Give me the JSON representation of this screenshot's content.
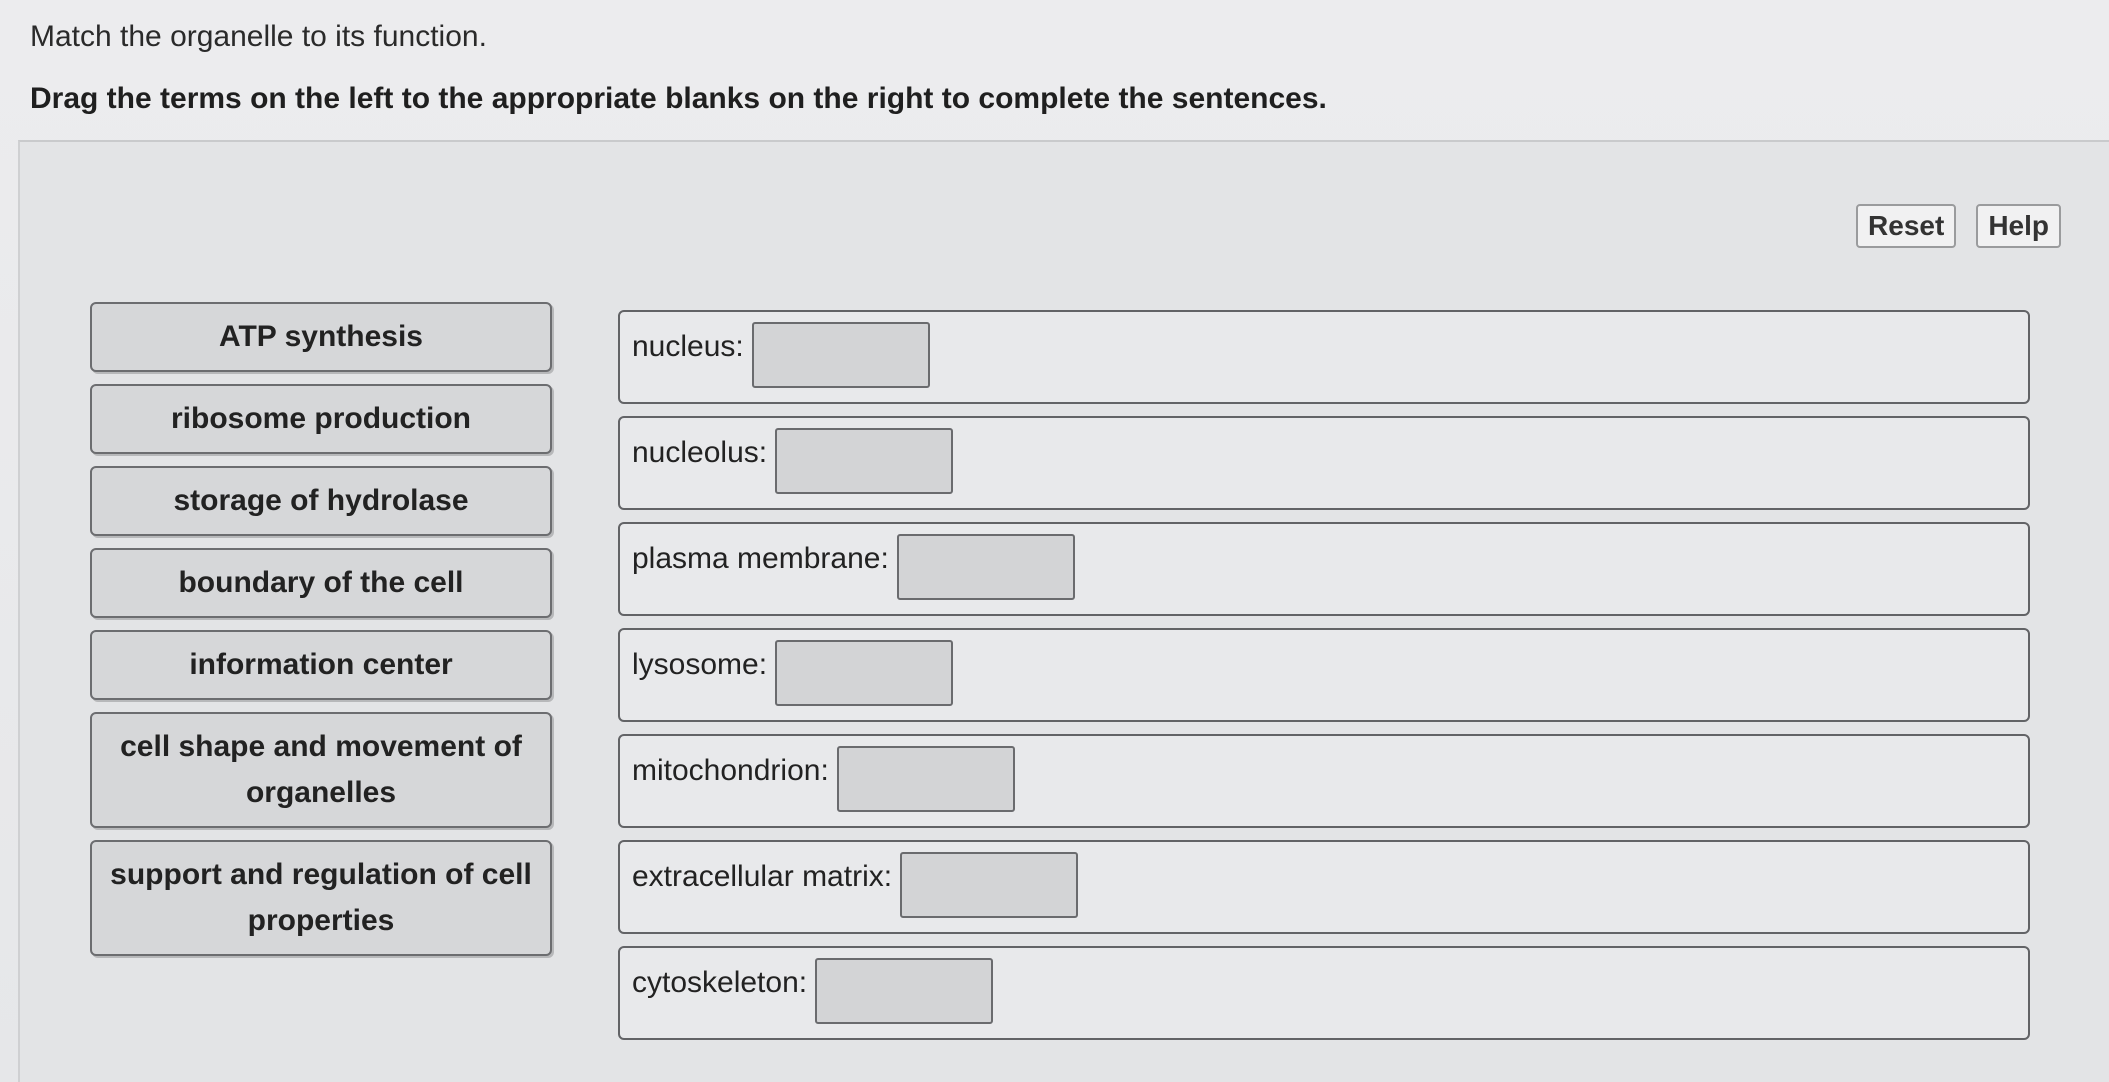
{
  "instructions": {
    "line1": "Match the organelle to its function.",
    "line2": "Drag the terms on the left to the appropriate blanks on the right to complete the sentences."
  },
  "toolbar": {
    "reset_label": "Reset",
    "help_label": "Help"
  },
  "terms": [
    {
      "label": "ATP synthesis"
    },
    {
      "label": "ribosome production"
    },
    {
      "label": "storage of hydrolase"
    },
    {
      "label": "boundary of the cell"
    },
    {
      "label": "information center"
    },
    {
      "label": "cell shape and movement of organelles"
    },
    {
      "label": "support and regulation of cell properties"
    }
  ],
  "targets": [
    {
      "label": "nucleus:"
    },
    {
      "label": "nucleolus:"
    },
    {
      "label": "plasma membrane:"
    },
    {
      "label": "lysosome:"
    },
    {
      "label": "mitochondrion:"
    },
    {
      "label": "extracellular matrix:"
    },
    {
      "label": "cytoskeleton:"
    }
  ],
  "colors": {
    "term_background": "#d6d7d9",
    "border": "#626366",
    "page_background": "#e6e7e9"
  }
}
